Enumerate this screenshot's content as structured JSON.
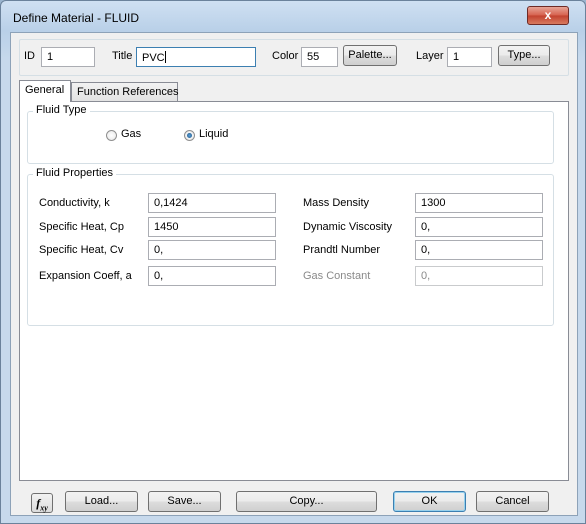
{
  "window": {
    "title": "Define Material - FLUID",
    "close_glyph": "x"
  },
  "header": {
    "id_label": "ID",
    "id_value": "1",
    "title_label": "Title",
    "title_value": "PVC",
    "color_label": "Color",
    "color_value": "55",
    "palette_button": "Palette...",
    "layer_label": "Layer",
    "layer_value": "1",
    "type_button": "Type..."
  },
  "tabs": [
    {
      "label": "General",
      "active": true
    },
    {
      "label": "Function References",
      "active": false
    }
  ],
  "fluid_type": {
    "group_title": "Fluid Type",
    "options": [
      {
        "label": "Gas",
        "checked": false
      },
      {
        "label": "Liquid",
        "checked": true
      }
    ]
  },
  "fluid_properties": {
    "group_title": "Fluid Properties",
    "left": [
      {
        "label": "Conductivity, k",
        "value": "0,1424"
      },
      {
        "label": "Specific Heat, Cp",
        "value": "1450"
      },
      {
        "label": "Specific Heat, Cv",
        "value": "0,"
      },
      {
        "label": "Expansion Coeff, a",
        "value": "0,"
      }
    ],
    "right": [
      {
        "label": "Mass Density",
        "value": "1300",
        "enabled": true
      },
      {
        "label": "Dynamic Viscosity",
        "value": "0,",
        "enabled": true
      },
      {
        "label": "Prandtl Number",
        "value": "0,",
        "enabled": true
      },
      {
        "label": "Gas Constant",
        "value": "0,",
        "enabled": false
      }
    ]
  },
  "footer": {
    "fxy_icon": "fxy-function-icon",
    "load_button": "Load...",
    "save_button": "Save...",
    "copy_button": "Copy...",
    "ok_button": "OK",
    "cancel_button": "Cancel"
  },
  "colors": {
    "title_bar": "#c7d9ec",
    "dialog_bg": "#f0f0f0",
    "close_button": "#c2412e",
    "focus_border": "#3c7fb1"
  }
}
